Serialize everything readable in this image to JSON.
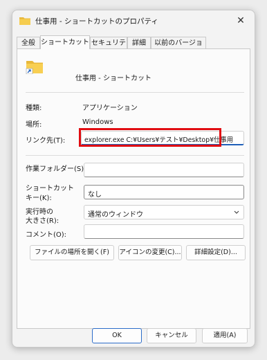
{
  "window": {
    "title": "仕事用 - ショートカットのプロパティ",
    "close_glyph": "✕"
  },
  "tabs": [
    "全般",
    "ショートカット",
    "セキュリティ",
    "詳細",
    "以前のバージョン"
  ],
  "header": {
    "name": "仕事用 - ショートカット"
  },
  "info": {
    "type_label": "種類:",
    "type_value": "アプリケーション",
    "location_label": "場所:",
    "location_value": "Windows",
    "target_label": "リンク先(T):",
    "target_value": "explorer.exe C:¥Users¥テスト¥Desktop¥仕事用"
  },
  "fields": {
    "workdir_label": "作業フォルダー(S):",
    "workdir_value": "",
    "shortcut_label_1": "ショートカット",
    "shortcut_label_2": "キー(K):",
    "shortcut_value": "なし",
    "run_label_1": "実行時の",
    "run_label_2": "大きさ(R):",
    "run_value": "通常のウィンドウ",
    "comment_label": "コメント(O):",
    "comment_value": ""
  },
  "panel_buttons": {
    "open_location": "ファイルの場所を開く(F)",
    "change_icon": "アイコンの変更(C)...",
    "advanced": "詳細設定(D)..."
  },
  "footer": {
    "ok": "OK",
    "cancel": "キャンセル",
    "apply": "適用(A)"
  },
  "colors": {
    "highlight": "#e10d12",
    "accent": "#2b6cc9"
  }
}
